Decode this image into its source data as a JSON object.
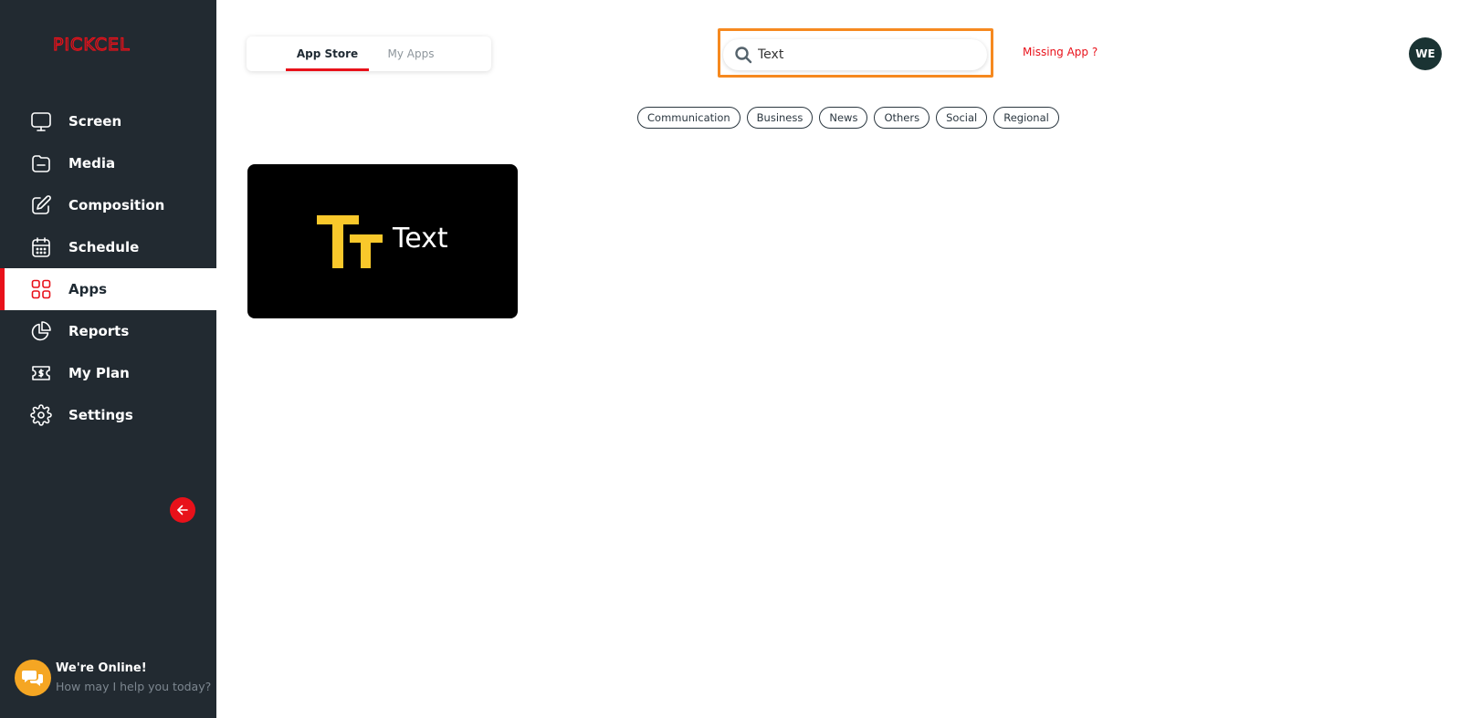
{
  "brand": {
    "logo_text": "PICKCEL",
    "accent_color": "#e8111a"
  },
  "sidebar": {
    "items": [
      {
        "label": "Screen",
        "icon": "monitor-icon",
        "active": false
      },
      {
        "label": "Media",
        "icon": "folder-icon",
        "active": false
      },
      {
        "label": "Composition",
        "icon": "edit-icon",
        "active": false
      },
      {
        "label": "Schedule",
        "icon": "calendar-icon",
        "active": false
      },
      {
        "label": "Apps",
        "icon": "apps-grid-icon",
        "active": true
      },
      {
        "label": "Reports",
        "icon": "pie-chart-icon",
        "active": false
      },
      {
        "label": "My Plan",
        "icon": "dollar-ticket-icon",
        "active": false
      },
      {
        "label": "Settings",
        "icon": "gear-icon",
        "active": false
      }
    ],
    "collapse_icon": "arrow-left-icon",
    "chat": {
      "title": "We're Online!",
      "subtitle": "How may I help you today?",
      "icon": "chat-bubbles-icon"
    }
  },
  "tabs": [
    {
      "label": "App Store",
      "active": true
    },
    {
      "label": "My Apps",
      "active": false
    }
  ],
  "search": {
    "value": "Text",
    "placeholder": "",
    "icon": "search-icon"
  },
  "missing_app_label": "Missing App ?",
  "user": {
    "initials": "WE"
  },
  "categories": [
    "Communication",
    "Business",
    "News",
    "Others",
    "Social",
    "Regional"
  ],
  "apps": [
    {
      "name": "Text",
      "logo": "text-tt-icon",
      "logo_color": "#f9c82b"
    }
  ]
}
